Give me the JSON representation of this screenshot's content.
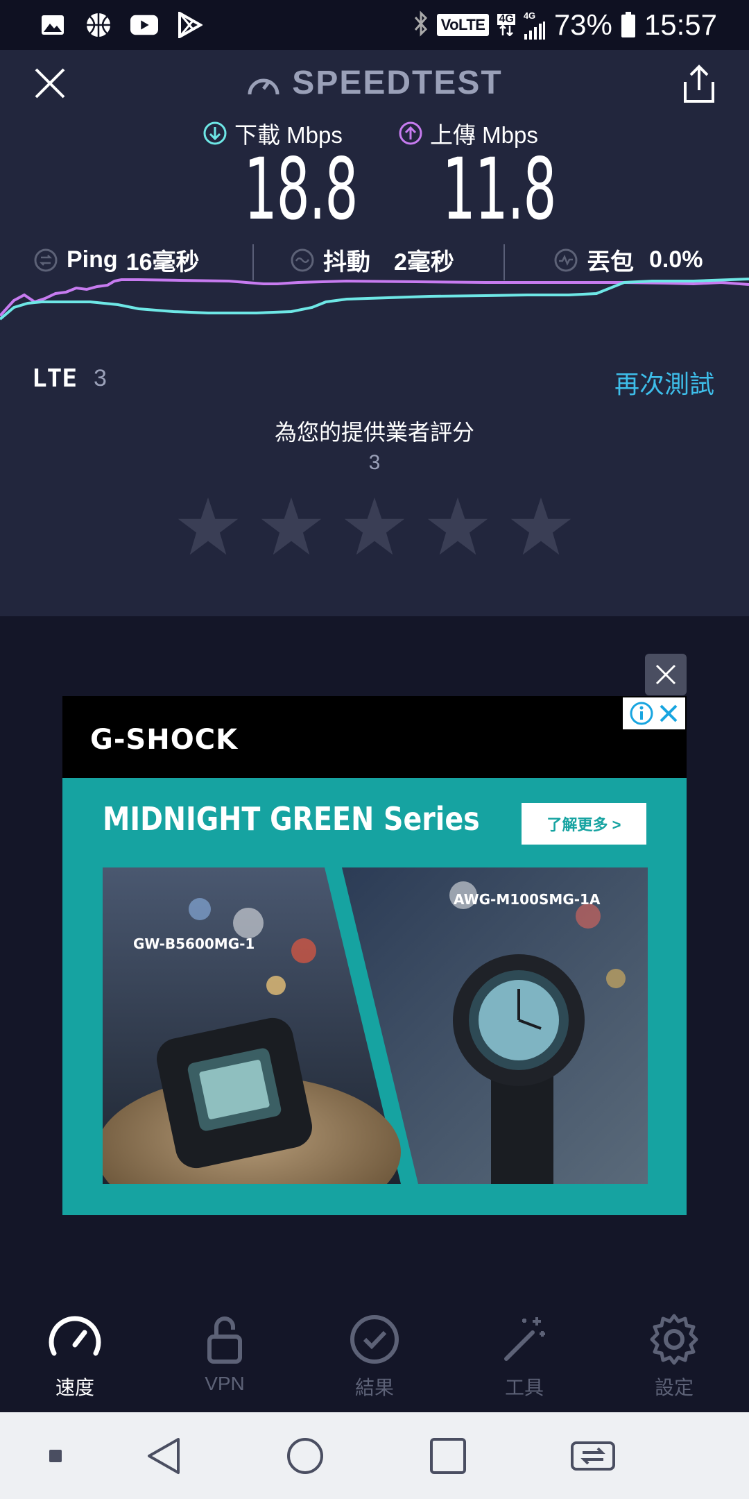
{
  "status_bar": {
    "left_icons": [
      "gallery-icon",
      "basketball-icon",
      "youtube-icon",
      "play-store-icon"
    ],
    "volte": "VoLTE",
    "network": "4G",
    "battery": "73%",
    "time": "15:57"
  },
  "header": {
    "brand": "SPEEDTEST"
  },
  "results": {
    "download_label": "下載 Mbps",
    "download_value": "18.8",
    "upload_label": "上傳 Mbps",
    "upload_value": "11.8",
    "ping_label": "Ping",
    "ping_value": "16毫秒",
    "jitter_label": "抖動",
    "jitter_value": "2毫秒",
    "loss_label": "丟包",
    "loss_value": "0.0%",
    "connection_type": "LTE",
    "connection_num": "3",
    "retest_label": "再次測試"
  },
  "rating": {
    "title": "為您的提供業者評分",
    "value": "3",
    "stars_total": 5,
    "stars_filled": 0
  },
  "ad": {
    "logo": "G-SHOCK",
    "headline": "MIDNIGHT GREEN Series",
    "cta": "了解更多 >",
    "model_left": "GW-B5600MG-1",
    "model_right": "AWG-M100SMG-1A"
  },
  "tabs": [
    {
      "label": "速度",
      "icon": "speedometer-icon",
      "active": true
    },
    {
      "label": "VPN",
      "icon": "lock-icon",
      "active": false
    },
    {
      "label": "結果",
      "icon": "check-circle-icon",
      "active": false
    },
    {
      "label": "工具",
      "icon": "magic-wand-icon",
      "active": false
    },
    {
      "label": "設定",
      "icon": "gear-icon",
      "active": false
    }
  ],
  "colors": {
    "download": "#6ee7e6",
    "upload": "#c77bf0",
    "accent": "#3ebeea"
  }
}
